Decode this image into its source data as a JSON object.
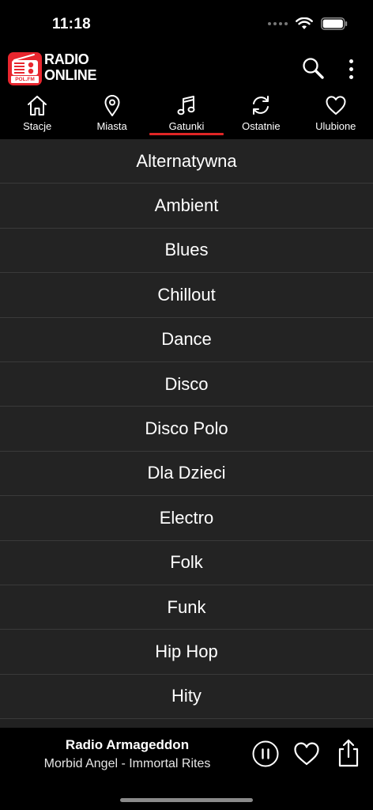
{
  "status_bar": {
    "time": "11:18"
  },
  "header": {
    "logo_badge": "POL.FM",
    "title_line1": "RADIO",
    "title_line2": "ONLINE"
  },
  "tabs": [
    {
      "label": "Stacje",
      "icon": "home-icon"
    },
    {
      "label": "Miasta",
      "icon": "location-pin-icon"
    },
    {
      "label": "Gatunki",
      "icon": "music-note-icon",
      "active": true
    },
    {
      "label": "Ostatnie",
      "icon": "refresh-icon"
    },
    {
      "label": "Ulubione",
      "icon": "heart-icon"
    }
  ],
  "genres": [
    "Alternatywna",
    "Ambient",
    "Blues",
    "Chillout",
    "Dance",
    "Disco",
    "Disco Polo",
    "Dla Dzieci",
    "Electro",
    "Folk",
    "Funk",
    "Hip Hop",
    "Hity"
  ],
  "player": {
    "station": "Radio Armageddon",
    "track": "Morbid Angel - Immortal Rites"
  },
  "colors": {
    "accent": "#e02525",
    "list_bg": "#232323",
    "divider": "#3a3a3a"
  }
}
